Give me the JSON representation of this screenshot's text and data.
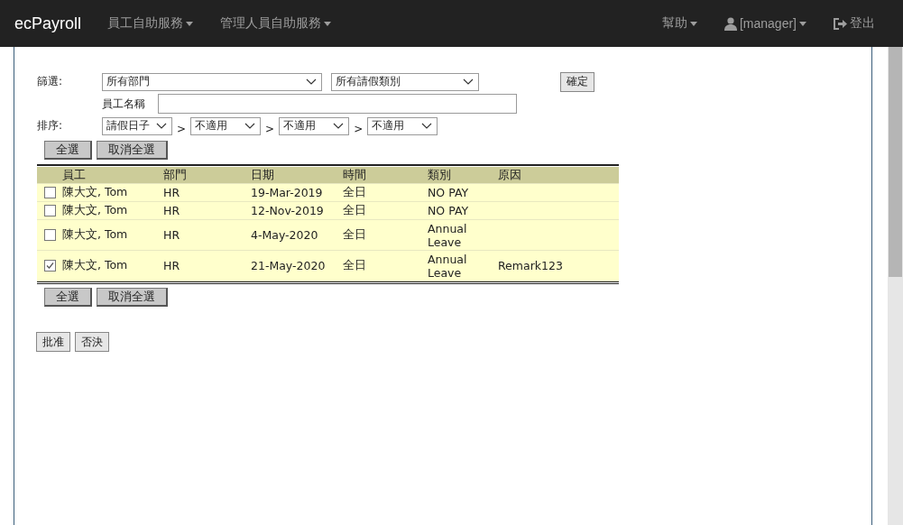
{
  "navbar": {
    "brand": "ecPayroll",
    "left_menus": [
      {
        "label": "員工自助服務",
        "dropdown": true
      },
      {
        "label": "管理人員自助服務",
        "dropdown": true
      }
    ],
    "right_menus": [
      {
        "label": "幫助",
        "kind": "plain",
        "dropdown": true
      },
      {
        "label": "[manager]",
        "kind": "user",
        "dropdown": true
      },
      {
        "label": "登出",
        "kind": "logout",
        "dropdown": false
      }
    ]
  },
  "filter": {
    "label": "篩選:",
    "department": "所有部門",
    "leave_type": "所有請假類別",
    "confirm": "確定",
    "name_label": "員工名稱"
  },
  "sort": {
    "label": "排序:",
    "separator": ">",
    "keys": [
      "請假日子",
      "不適用",
      "不適用",
      "不適用"
    ]
  },
  "select_buttons_top": [
    "全選",
    "取消全選"
  ],
  "table": {
    "columns": [
      "員工",
      "部門",
      "日期",
      "時間",
      "類別",
      "原因"
    ],
    "rows": [
      {
        "checked": false,
        "employee": "陳大文, Tom",
        "department": "HR",
        "date": "19-Mar-2019",
        "time": "全日",
        "type": "NO PAY"
      },
      {
        "checked": false,
        "employee": "陳大文, Tom",
        "department": "HR",
        "date": "12-Nov-2019",
        "time": "全日",
        "type": "NO PAY"
      },
      {
        "checked": false,
        "employee": "陳大文, Tom",
        "department": "HR",
        "date": "4-May-2020",
        "time": "全日",
        "type": "Annual Leave"
      },
      {
        "checked": true,
        "employee": "陳大文, Tom",
        "department": "HR",
        "date": "21-May-2020",
        "time": "全日",
        "type": "Annual Leave",
        "reason": "Remark123"
      }
    ]
  },
  "select_buttons_bottom": [
    "全選",
    "取消全選"
  ],
  "action_buttons": [
    "批准",
    "否決"
  ]
}
